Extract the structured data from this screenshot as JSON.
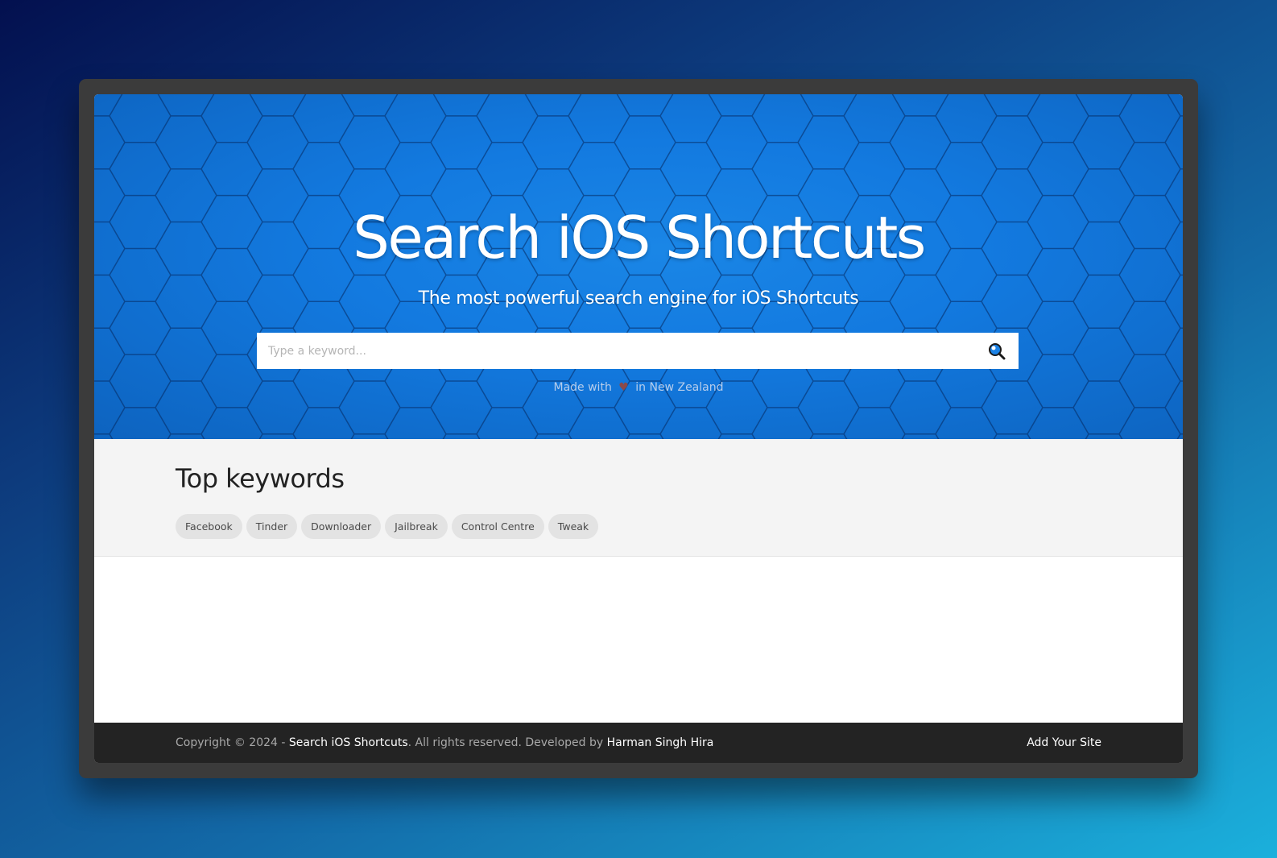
{
  "hero": {
    "title": "Search iOS Shortcuts",
    "subtitle": "The most powerful search engine for iOS Shortcuts",
    "search_placeholder": "Type a keyword...",
    "search_icon": "magnifier-icon",
    "made_with_prefix": "Made with",
    "heart_glyph": "♥",
    "made_with_suffix": "in New Zealand"
  },
  "keywords": {
    "title": "Top keywords",
    "items": [
      "Facebook",
      "Tinder",
      "Downloader",
      "Jailbreak",
      "Control Centre",
      "Tweak"
    ]
  },
  "footer": {
    "copyright_prefix": "Copyright © 2024 -",
    "site_link": "Search iOS Shortcuts",
    "rights_text": ". All rights reserved. Developed by",
    "developer_link": "Harman Singh Hira",
    "add_site": "Add Your Site"
  },
  "colors": {
    "hero_blue": "#137ae0",
    "footer_bg": "#232323",
    "keywords_bg": "#f4f4f4",
    "chip_bg": "#e3e3e3"
  }
}
